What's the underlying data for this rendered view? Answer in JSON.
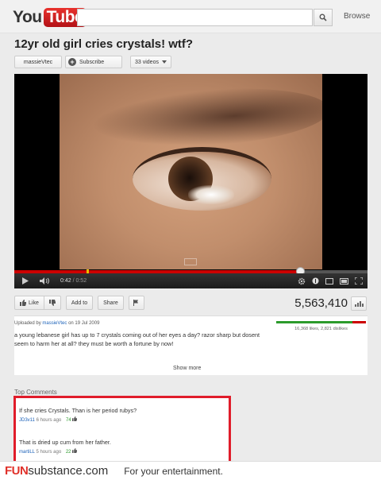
{
  "header": {
    "logo_you": "You",
    "logo_tube": "Tube",
    "search_placeholder": "",
    "browse_label": "Browse"
  },
  "video": {
    "title": "12yr old girl cries crystals! wtf?",
    "channel_name": "massieVtec",
    "subscribe_label": "Subscribe",
    "videos_count_label": "33 videos"
  },
  "player": {
    "current_time": "0:42",
    "duration": "/ 0:52",
    "progress_fraction": 0.808,
    "buffer_marker_fraction": 0.205
  },
  "actions": {
    "like_label": "Like",
    "add_to_label": "Add to",
    "share_label": "Share",
    "view_count": "5,563,410"
  },
  "description": {
    "uploaded_prefix": "Uploaded by",
    "uploader": "massieVtec",
    "uploaded_date": "on 19 Jul 2009",
    "text": "a young lebanese girl has up to 7 crystals coming out of her eyes a day? razor sharp but dosent seem to harm her at all? they must be worth a fortune by now!",
    "likes_dislikes": "16,368 likes, 2,821 dislikes",
    "like_ratio": 0.853,
    "show_more_label": "Show more"
  },
  "comments": {
    "heading": "Top Comments",
    "items": [
      {
        "text": "If she cries Crystals. Than is her period rubys?",
        "author": "JD3v11",
        "time": "6 hours ago",
        "score": "74"
      },
      {
        "text": "That is dried up cum from her father.",
        "author": "martiLL",
        "time": "5 hours ago",
        "score": "22"
      }
    ]
  },
  "footer": {
    "brand_bold": "FUN",
    "brand_rest": "substance.com",
    "tagline": "For your entertainment."
  },
  "colors": {
    "accent_red": "#e01c2a",
    "link_blue": "#1c62b9",
    "like_green": "#2c9b2c"
  }
}
